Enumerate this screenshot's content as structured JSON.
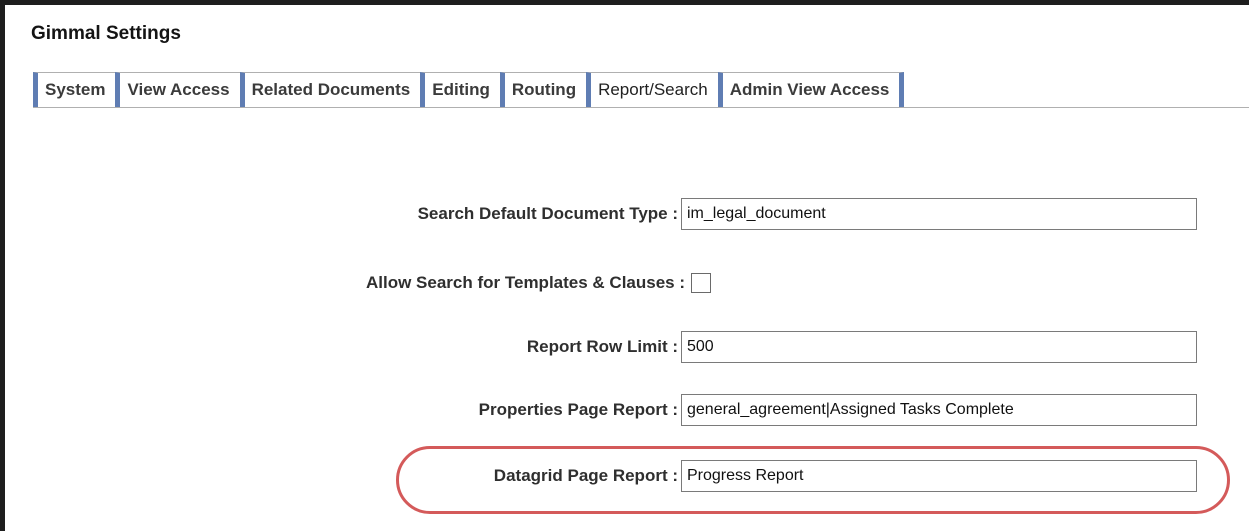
{
  "window": {
    "title": "Gimmal Settings"
  },
  "tabs": [
    {
      "label": "System",
      "active": false
    },
    {
      "label": "View Access",
      "active": false
    },
    {
      "label": "Related Documents",
      "active": false
    },
    {
      "label": "Editing",
      "active": false
    },
    {
      "label": "Routing",
      "active": false
    },
    {
      "label": "Report/Search",
      "active": true
    },
    {
      "label": "Admin View Access",
      "active": false
    }
  ],
  "form": {
    "search_default_doc_type": {
      "label": "Search Default Document Type :",
      "value": "im_legal_document"
    },
    "allow_search_templates": {
      "label": "Allow Search for Templates & Clauses :",
      "checked": false
    },
    "report_row_limit": {
      "label": "Report Row Limit :",
      "value": "500"
    },
    "properties_page_report": {
      "label": "Properties Page Report :",
      "value": "general_agreement|Assigned Tasks Complete"
    },
    "datagrid_page_report": {
      "label": "Datagrid Page Report :",
      "value": "Progress Report"
    }
  },
  "colors": {
    "tab_accent": "#5f7db3",
    "highlight": "#d45a5a"
  }
}
